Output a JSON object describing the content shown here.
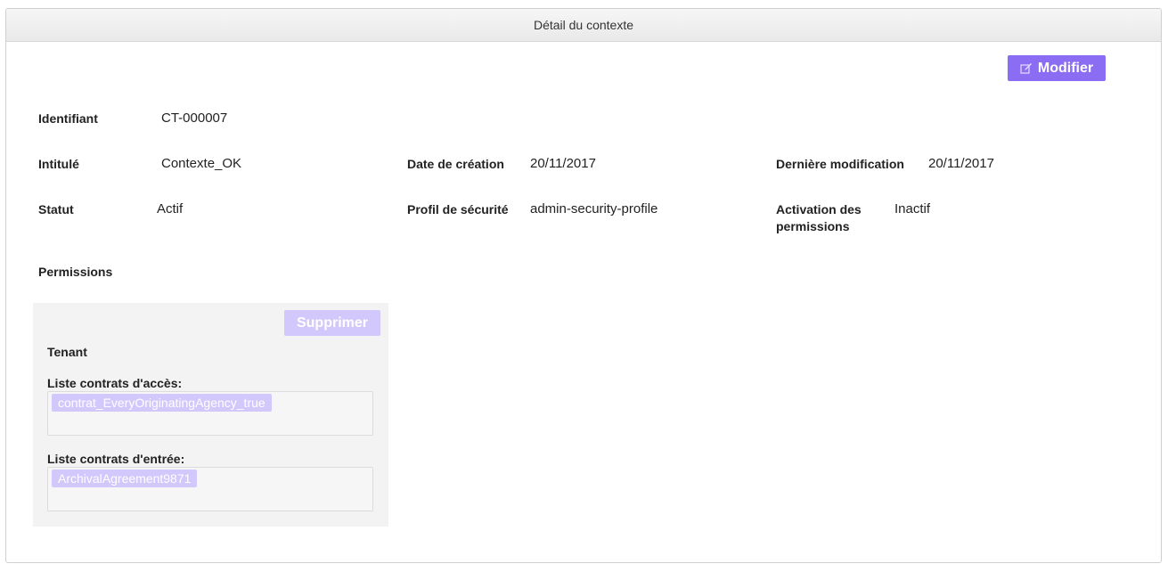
{
  "header": {
    "title": "Détail du contexte"
  },
  "toolbar": {
    "edit_label": "Modifier"
  },
  "fields": {
    "identifiant": {
      "label": "Identifiant",
      "value": "CT-000007"
    },
    "intitule": {
      "label": "Intitulé",
      "value": "Contexte_OK"
    },
    "date_creation": {
      "label": "Date de création",
      "value": "20/11/2017"
    },
    "derniere_modification": {
      "label": "Dernière modification",
      "value": "20/11/2017"
    },
    "statut": {
      "label": "Statut",
      "value": "Actif"
    },
    "profil_securite": {
      "label": "Profil de sécurité",
      "value": "admin-security-profile"
    },
    "activation_permissions": {
      "label_line1": "Activation des",
      "label_line2": "permissions",
      "value": "Inactif"
    }
  },
  "permissions": {
    "section_label": "Permissions",
    "delete_label": "Supprimer",
    "tenant_label": "Tenant",
    "access_contracts": {
      "label": "Liste contrats d'accès:",
      "tags": [
        "contrat_EveryOriginatingAgency_true"
      ]
    },
    "ingest_contracts": {
      "label": "Liste contrats d'entrée:",
      "tags": [
        "ArchivalAgreement9871"
      ]
    }
  },
  "colors": {
    "accent": "#8a6df2",
    "accent_disabled": "#d3c8fb"
  }
}
